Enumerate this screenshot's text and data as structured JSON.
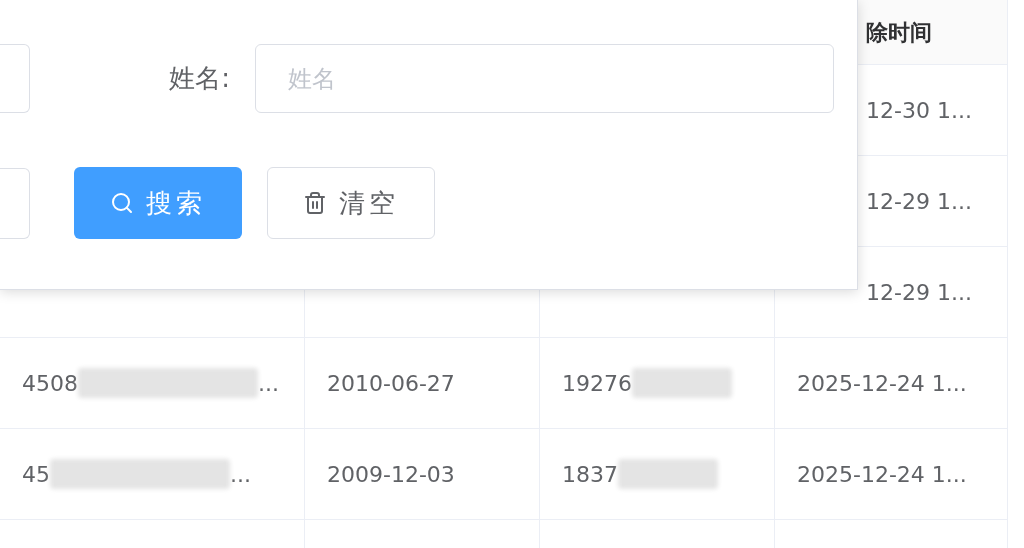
{
  "search_panel": {
    "field": {
      "label": "姓名:",
      "placeholder": "姓名"
    },
    "buttons": [
      {
        "label": "搜索",
        "kind": "primary"
      },
      {
        "label": "清空",
        "kind": "default"
      }
    ]
  },
  "table": {
    "last_column_header": "除时间",
    "rows": [
      {
        "covered": true,
        "column_4": "12-30 1..."
      },
      {
        "covered": true,
        "column_4": "12-29 1..."
      },
      {
        "covered": true,
        "column_4": "12-29 1..."
      },
      {
        "covered": false,
        "cells": [
          {
            "text": "4508",
            "redacted": true,
            "tail": "..."
          },
          {
            "text": "2010-06-27",
            "redacted": false
          },
          {
            "text": "19276",
            "redacted": true
          },
          {
            "text": "2025-12-24 1...",
            "redacted": false
          }
        ]
      },
      {
        "covered": false,
        "cells": [
          {
            "text": "45",
            "redacted": true,
            "tail": "..."
          },
          {
            "text": "2009-12-03",
            "redacted": false
          },
          {
            "text": "1837",
            "redacted": true
          },
          {
            "text": "2025-12-24 1...",
            "redacted": false
          }
        ]
      }
    ]
  }
}
